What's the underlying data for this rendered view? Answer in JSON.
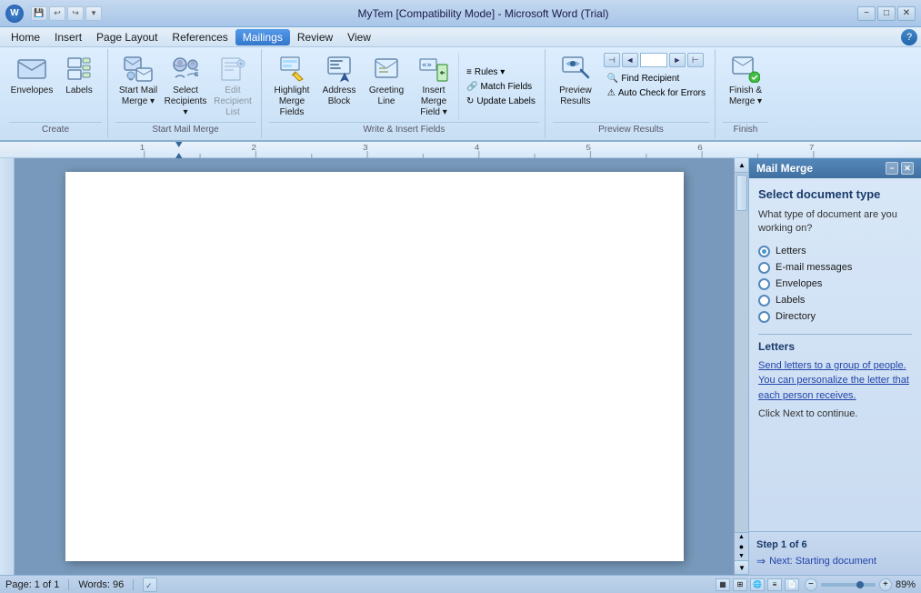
{
  "titlebar": {
    "title": "MyTem [Compatibility Mode] - Microsoft Word (Trial)",
    "minimize": "−",
    "maximize": "□",
    "close": "✕"
  },
  "quickaccess": {
    "icons": [
      "💾",
      "↩",
      "↪",
      "▾"
    ]
  },
  "menubar": {
    "items": [
      "Home",
      "Insert",
      "Page Layout",
      "References",
      "Mailings",
      "Review",
      "View"
    ],
    "active": "Mailings"
  },
  "ribbon": {
    "groups": [
      {
        "label": "Create",
        "buttons": [
          {
            "id": "envelopes",
            "label": "Envelopes",
            "icon": "✉",
            "size": "large"
          },
          {
            "id": "labels",
            "label": "Labels",
            "icon": "🏷",
            "size": "large"
          }
        ]
      },
      {
        "label": "Start Mail Merge",
        "buttons": [
          {
            "id": "start-mail-merge",
            "label": "Start Mail\nMerge ▾",
            "icon": "📧",
            "size": "large"
          },
          {
            "id": "select-recipients",
            "label": "Select\nRecipients ▾",
            "icon": "👥",
            "size": "large"
          },
          {
            "id": "edit-recipient-list",
            "label": "Edit\nRecipient List",
            "icon": "📋",
            "size": "large"
          }
        ]
      },
      {
        "label": "Write & Insert Fields",
        "smallButtons": [
          {
            "id": "rules",
            "label": "▾ Rules"
          },
          {
            "id": "match-fields",
            "label": "🔗 Match Fields"
          },
          {
            "id": "update-labels",
            "label": "↻ Update Labels"
          }
        ],
        "buttons": [
          {
            "id": "highlight-merge-fields",
            "label": "Highlight\nMerge Fields",
            "icon": "🖊",
            "size": "large"
          },
          {
            "id": "address-block",
            "label": "Address\nBlock",
            "icon": "📫",
            "size": "large"
          },
          {
            "id": "greeting-line",
            "label": "Greeting\nLine",
            "icon": "📝",
            "size": "large"
          },
          {
            "id": "insert-merge-field",
            "label": "Insert Merge\nField ▾",
            "icon": "⊞",
            "size": "large"
          }
        ]
      },
      {
        "label": "Preview Results",
        "navButtons": [
          "⊣",
          "◄",
          "",
          "►",
          "⊢"
        ],
        "buttons": [
          {
            "id": "preview-results",
            "label": "Preview\nResults",
            "icon": "🔍",
            "size": "large"
          }
        ],
        "smallButtons2": [
          {
            "id": "find-recipient",
            "label": "🔍 Find Recipient"
          },
          {
            "id": "auto-check",
            "label": "⚠ Auto Check for Errors"
          }
        ]
      },
      {
        "label": "Finish",
        "buttons": [
          {
            "id": "finish-merge",
            "label": "Finish &\nMerge ▾",
            "icon": "✅",
            "size": "large"
          }
        ]
      }
    ]
  },
  "panel": {
    "title": "Mail Merge",
    "sectionTitle": "Select document type",
    "question": "What type of document are you working on?",
    "options": [
      {
        "id": "letters",
        "label": "Letters",
        "checked": true
      },
      {
        "id": "email-messages",
        "label": "E-mail messages",
        "checked": false
      },
      {
        "id": "envelopes",
        "label": "Envelopes",
        "checked": false
      },
      {
        "id": "labels",
        "label": "Labels",
        "checked": false
      },
      {
        "id": "directory",
        "label": "Directory",
        "checked": false
      }
    ],
    "infoTitle": "Letters",
    "infoText": "Send letters to a group of people. You can personalize the letter that each person receives.",
    "clickNext": "Click Next to continue.",
    "stepLabel": "Step 1 of 6",
    "nextLabel": "Next: Starting document"
  },
  "statusbar": {
    "page": "Page: 1 of 1",
    "words": "Words: 96",
    "zoom": "89%"
  }
}
